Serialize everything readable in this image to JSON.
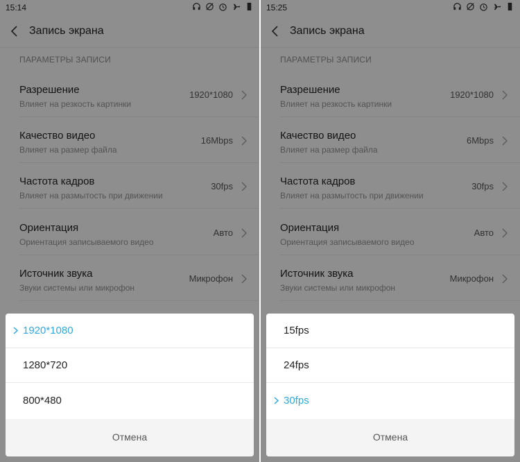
{
  "panels": [
    {
      "status": {
        "time": "15:14"
      },
      "header": {
        "title": "Запись экрана"
      },
      "section": "ПАРАМЕТРЫ ЗАПИСИ",
      "rows": [
        {
          "label": "Разрешение",
          "desc": "Влияет на резкость картинки",
          "value": "1920*1080"
        },
        {
          "label": "Качество видео",
          "desc": "Влияет на размер файла",
          "value": "16Mbps"
        },
        {
          "label": "Частота кадров",
          "desc": "Влияет на размытость при движении",
          "value": "30fps"
        },
        {
          "label": "Ориентация",
          "desc": "Ориентация записываемого видео",
          "value": "Авто"
        },
        {
          "label": "Источник звука",
          "desc": "Звуки системы или микрофон",
          "value": "Микрофон"
        }
      ],
      "options": [
        "1920*1080",
        "1280*720",
        "800*480"
      ],
      "selected": 0,
      "cancel": "Отмена"
    },
    {
      "status": {
        "time": "15:25"
      },
      "header": {
        "title": "Запись экрана"
      },
      "section": "ПАРАМЕТРЫ ЗАПИСИ",
      "rows": [
        {
          "label": "Разрешение",
          "desc": "Влияет на резкость картинки",
          "value": "1920*1080"
        },
        {
          "label": "Качество видео",
          "desc": "Влияет на размер файла",
          "value": "6Mbps"
        },
        {
          "label": "Частота кадров",
          "desc": "Влияет на размытость при движении",
          "value": "30fps"
        },
        {
          "label": "Ориентация",
          "desc": "Ориентация записываемого видео",
          "value": "Авто"
        },
        {
          "label": "Источник звука",
          "desc": "Звуки системы или микрофон",
          "value": "Микрофон"
        }
      ],
      "options": [
        "15fps",
        "24fps",
        "30fps"
      ],
      "selected": 2,
      "cancel": "Отмена"
    }
  ],
  "status_icons": [
    "headphones-icon",
    "sync-off-icon",
    "alarm-icon",
    "airplane-mode-icon",
    "battery-icon"
  ],
  "colors": {
    "accent": "#2fa7e0",
    "dim_overlay": "rgba(0,0,0,0.42)"
  }
}
